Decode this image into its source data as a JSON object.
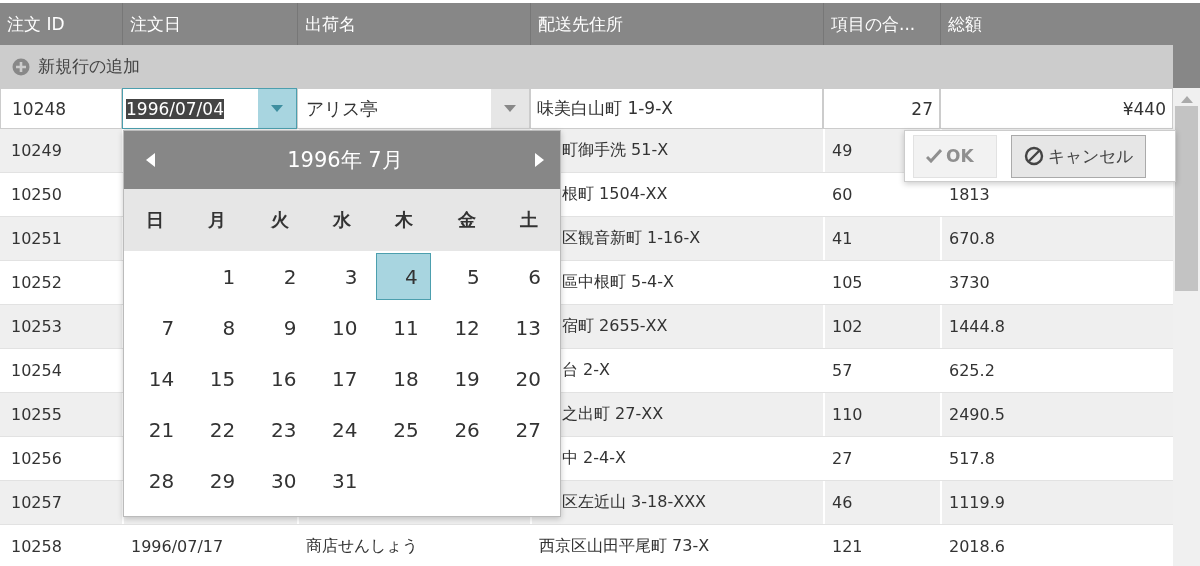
{
  "columns": [
    "注文 ID",
    "注文日",
    "出荷名",
    "配送先住所",
    "項目の合...",
    "総額"
  ],
  "new_row": {
    "label": "新規行の追加"
  },
  "edit_row": {
    "id": "10248",
    "order_date": "1996/07/04",
    "ship_name": "アリス亭",
    "address": "味美白山町 1-9-X",
    "items": "27",
    "total": "¥440"
  },
  "rows": [
    {
      "id": "10249",
      "address": "町御手洗 51-X",
      "items": "49"
    },
    {
      "id": "10250",
      "address": "根町 1504-XX",
      "items": "60",
      "total": "1813"
    },
    {
      "id": "10251",
      "address": "区観音新町 1-16-X",
      "items": "41",
      "total": "670.8"
    },
    {
      "id": "10252",
      "address": "區中根町 5-4-X",
      "items": "105",
      "total": "3730"
    },
    {
      "id": "10253",
      "address": "宿町 2655-XX",
      "items": "102",
      "total": "1444.8"
    },
    {
      "id": "10254",
      "address": "台 2-X",
      "items": "57",
      "total": "625.2"
    },
    {
      "id": "10255",
      "address": "之出町 27-XX",
      "items": "110",
      "total": "2490.5"
    },
    {
      "id": "10256",
      "address": "中 2-4-X",
      "items": "27",
      "total": "517.8"
    },
    {
      "id": "10257",
      "address": "区左近山 3-18-XXX",
      "items": "46",
      "total": "1119.9"
    },
    {
      "id": "10258",
      "order_date": "1996/07/17",
      "ship_name": "商店せんしょう",
      "address": "西京区山田平尾町 73-X",
      "items": "121",
      "total": "2018.6"
    }
  ],
  "calendar": {
    "title": "1996年 7月",
    "weekdays": [
      "日",
      "月",
      "火",
      "水",
      "木",
      "金",
      "土"
    ],
    "weeks": [
      [
        {
          "label": "1",
          "selected": false
        },
        {
          "label": "2",
          "selected": false
        },
        {
          "label": "3",
          "selected": false
        },
        {
          "label": "4",
          "selected": true
        },
        {
          "label": "5",
          "selected": false
        },
        {
          "label": "6",
          "selected": false
        }
      ],
      [
        {
          "label": "7",
          "selected": false
        },
        {
          "label": "8",
          "selected": false
        },
        {
          "label": "9",
          "selected": false
        },
        {
          "label": "10",
          "selected": false
        },
        {
          "label": "11",
          "selected": false
        },
        {
          "label": "12",
          "selected": false
        },
        {
          "label": "13",
          "selected": false
        }
      ],
      [
        {
          "label": "14",
          "selected": false
        },
        {
          "label": "15",
          "selected": false
        },
        {
          "label": "16",
          "selected": false
        },
        {
          "label": "17",
          "selected": false
        },
        {
          "label": "18",
          "selected": false
        },
        {
          "label": "19",
          "selected": false
        },
        {
          "label": "20",
          "selected": false
        }
      ],
      [
        {
          "label": "21",
          "selected": false
        },
        {
          "label": "22",
          "selected": false
        },
        {
          "label": "23",
          "selected": false
        },
        {
          "label": "24",
          "selected": false
        },
        {
          "label": "25",
          "selected": false
        },
        {
          "label": "26",
          "selected": false
        },
        {
          "label": "27",
          "selected": false
        }
      ],
      [
        {
          "label": "28",
          "selected": false
        },
        {
          "label": "29",
          "selected": false
        },
        {
          "label": "30",
          "selected": false
        },
        {
          "label": "31",
          "selected": false
        }
      ]
    ]
  },
  "actions": [
    {
      "kind": "ok",
      "label": "OK",
      "disabled": true
    },
    {
      "kind": "cancel",
      "label": "キャンセル",
      "disabled": false
    }
  ]
}
